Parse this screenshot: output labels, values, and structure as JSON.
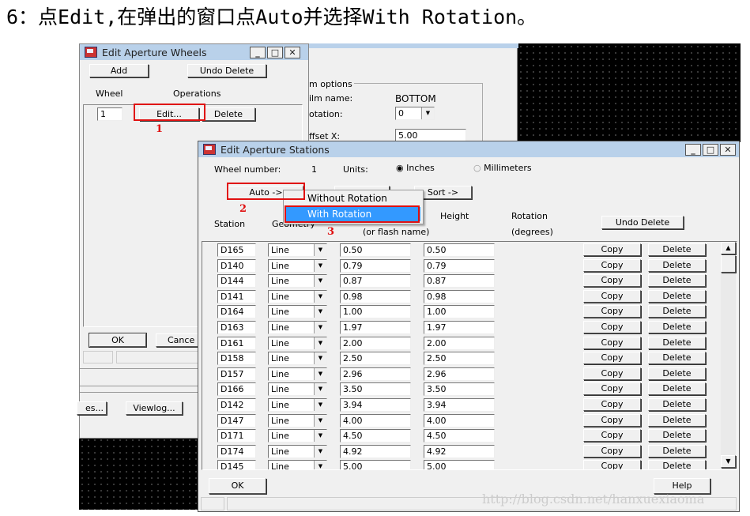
{
  "heading": "6：点Edit,在弹出的窗口点Auto并选择With Rotation。",
  "watermark": "http://blog.csdn.net/hanxuexiaoma",
  "film_window": {
    "group": "m options",
    "film_name_label": "ilm name:",
    "film_name": "BOTTOM",
    "rotation_label": "otation:",
    "rotation": "0",
    "offset_label": "ffset  X:",
    "offset_x": "5.00"
  },
  "wheels_window": {
    "title": "Edit Aperture Wheels",
    "add": "Add",
    "undo_delete": "Undo Delete",
    "col_wheel": "Wheel",
    "col_operations": "Operations",
    "wheel": "1",
    "edit": "Edit...",
    "delete": "Delete",
    "ok": "OK",
    "cancel": "Cance",
    "files": "es...",
    "viewlog": "Viewlog..."
  },
  "stations_window": {
    "title": "Edit Aperture Stations",
    "wheel_number_label": "Wheel number:",
    "wheel_number": "1",
    "units_label": "Units:",
    "inches": "Inches",
    "millimeters": "Millimeters",
    "units_selected": "Inches",
    "auto": "Auto ->",
    "sort": "Sort ->",
    "undo_delete": "Undo Delete",
    "col_station": "Station",
    "col_geometry": "Geometry",
    "col_width_sub": "(or flash name)",
    "col_height": "Height",
    "col_rotation": "Rotation",
    "col_rotation_sub": "(degrees)",
    "copy": "Copy",
    "delete": "Delete",
    "ok": "OK",
    "help": "Help",
    "rows": [
      {
        "station": "D165",
        "geometry": "Line",
        "width": "0.50",
        "height": "0.50"
      },
      {
        "station": "D140",
        "geometry": "Line",
        "width": "0.79",
        "height": "0.79"
      },
      {
        "station": "D144",
        "geometry": "Line",
        "width": "0.87",
        "height": "0.87"
      },
      {
        "station": "D141",
        "geometry": "Line",
        "width": "0.98",
        "height": "0.98"
      },
      {
        "station": "D164",
        "geometry": "Line",
        "width": "1.00",
        "height": "1.00"
      },
      {
        "station": "D163",
        "geometry": "Line",
        "width": "1.97",
        "height": "1.97"
      },
      {
        "station": "D161",
        "geometry": "Line",
        "width": "2.00",
        "height": "2.00"
      },
      {
        "station": "D158",
        "geometry": "Line",
        "width": "2.50",
        "height": "2.50"
      },
      {
        "station": "D157",
        "geometry": "Line",
        "width": "2.96",
        "height": "2.96"
      },
      {
        "station": "D166",
        "geometry": "Line",
        "width": "3.50",
        "height": "3.50"
      },
      {
        "station": "D142",
        "geometry": "Line",
        "width": "3.94",
        "height": "3.94"
      },
      {
        "station": "D147",
        "geometry": "Line",
        "width": "4.00",
        "height": "4.00"
      },
      {
        "station": "D171",
        "geometry": "Line",
        "width": "4.50",
        "height": "4.50"
      },
      {
        "station": "D174",
        "geometry": "Line",
        "width": "4.92",
        "height": "4.92"
      },
      {
        "station": "D145",
        "geometry": "Line",
        "width": "5.00",
        "height": "5.00"
      }
    ]
  },
  "auto_menu": {
    "items": [
      "Without Rotation",
      "With Rotation"
    ],
    "highlighted": "With Rotation",
    "highlight_color": "#3399ff"
  },
  "annotations": {
    "step1": "1",
    "step2": "2",
    "step3": "3",
    "color": "#e01010"
  }
}
